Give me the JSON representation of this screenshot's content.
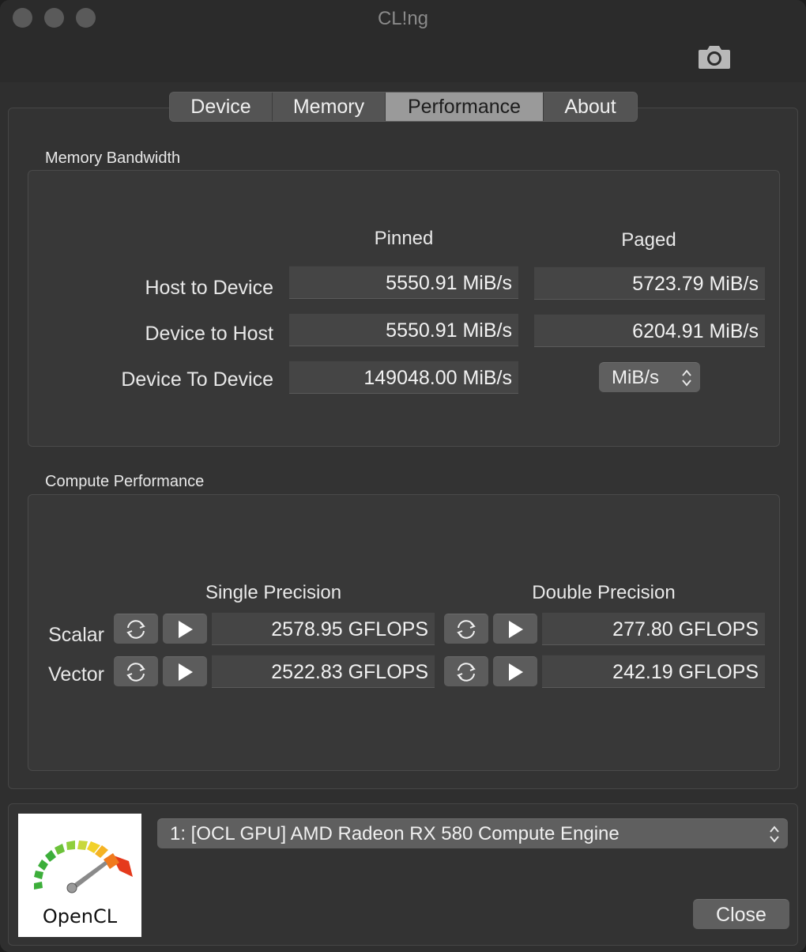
{
  "window": {
    "title": "CL!ng"
  },
  "toolbar": {
    "snapshot_icon": "camera-icon"
  },
  "tabs": [
    {
      "label": "Device",
      "active": false
    },
    {
      "label": "Memory",
      "active": false
    },
    {
      "label": "Performance",
      "active": true
    },
    {
      "label": "About",
      "active": false
    }
  ],
  "memory_bandwidth": {
    "group_label": "Memory Bandwidth",
    "columns": {
      "pinned": "Pinned",
      "paged": "Paged"
    },
    "rows": [
      {
        "label": "Host to Device",
        "pinned": "5550.91 MiB/s",
        "paged": "5723.79 MiB/s"
      },
      {
        "label": "Device to Host",
        "pinned": "5550.91 MiB/s",
        "paged": "6204.91 MiB/s"
      },
      {
        "label": "Device To Device",
        "pinned": "149048.00 MiB/s"
      }
    ],
    "unit_select": {
      "value": "MiB/s"
    }
  },
  "compute_performance": {
    "group_label": "Compute Performance",
    "columns": {
      "single": "Single Precision",
      "double": "Double Precision"
    },
    "rows": [
      {
        "label": "Scalar",
        "single": "2578.95 GFLOPS",
        "double": "277.80 GFLOPS"
      },
      {
        "label": "Vector",
        "single": "2522.83 GFLOPS",
        "double": "242.19 GFLOPS"
      }
    ],
    "icons": {
      "reset": "refresh-icon",
      "run": "play-icon"
    }
  },
  "footer": {
    "logo_text": "OpenCL",
    "device_select": {
      "value": "1: [OCL GPU] AMD Radeon RX 580 Compute Engine"
    },
    "close_label": "Close"
  },
  "colors": {
    "window_bg": "#2a2a2a",
    "active_tab": "#9a9a9a",
    "field_bg": "#454545",
    "button_bg": "#5c5c5c",
    "logo_red": "#e53a1c",
    "logo_green": "#3cae3a"
  }
}
